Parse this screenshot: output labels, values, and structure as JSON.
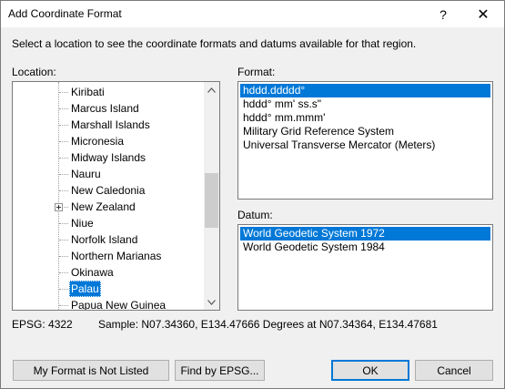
{
  "window": {
    "title": "Add Coordinate Format",
    "help_glyph": "?",
    "close_glyph": "✕"
  },
  "instruction": "Select a location to see the coordinate formats and datums available for that region.",
  "location": {
    "label": "Location:",
    "items": [
      {
        "label": "Kiribati",
        "expandable": false,
        "selected": false
      },
      {
        "label": "Marcus Island",
        "expandable": false,
        "selected": false
      },
      {
        "label": "Marshall Islands",
        "expandable": false,
        "selected": false
      },
      {
        "label": "Micronesia",
        "expandable": false,
        "selected": false
      },
      {
        "label": "Midway Islands",
        "expandable": false,
        "selected": false
      },
      {
        "label": "Nauru",
        "expandable": false,
        "selected": false
      },
      {
        "label": "New Caledonia",
        "expandable": false,
        "selected": false
      },
      {
        "label": "New Zealand",
        "expandable": true,
        "selected": false
      },
      {
        "label": "Niue",
        "expandable": false,
        "selected": false
      },
      {
        "label": "Norfolk Island",
        "expandable": false,
        "selected": false
      },
      {
        "label": "Northern Marianas",
        "expandable": false,
        "selected": false
      },
      {
        "label": "Okinawa",
        "expandable": false,
        "selected": false
      },
      {
        "label": "Palau",
        "expandable": false,
        "selected": true
      },
      {
        "label": "Papua New Guinea",
        "expandable": false,
        "selected": false
      }
    ]
  },
  "format": {
    "label": "Format:",
    "items": [
      {
        "label": "hddd.ddddd°",
        "selected": true
      },
      {
        "label": "hddd° mm' ss.s\"",
        "selected": false
      },
      {
        "label": "hddd° mm.mmm'",
        "selected": false
      },
      {
        "label": "Military Grid Reference System",
        "selected": false
      },
      {
        "label": "Universal Transverse Mercator (Meters)",
        "selected": false
      }
    ]
  },
  "datum": {
    "label": "Datum:",
    "items": [
      {
        "label": "World Geodetic System 1972",
        "selected": true
      },
      {
        "label": "World Geodetic System 1984",
        "selected": false
      }
    ]
  },
  "status": {
    "epsg": "EPSG: 4322",
    "sample": "Sample: N07.34360, E134.47666 Degrees at N07.34364, E134.47681"
  },
  "buttons": {
    "not_listed": "My Format is Not Listed",
    "find_epsg": "Find by EPSG...",
    "ok": "OK",
    "cancel": "Cancel"
  },
  "colors": {
    "selection": "#0078d7",
    "dialog_bg": "#f0f0f0"
  }
}
